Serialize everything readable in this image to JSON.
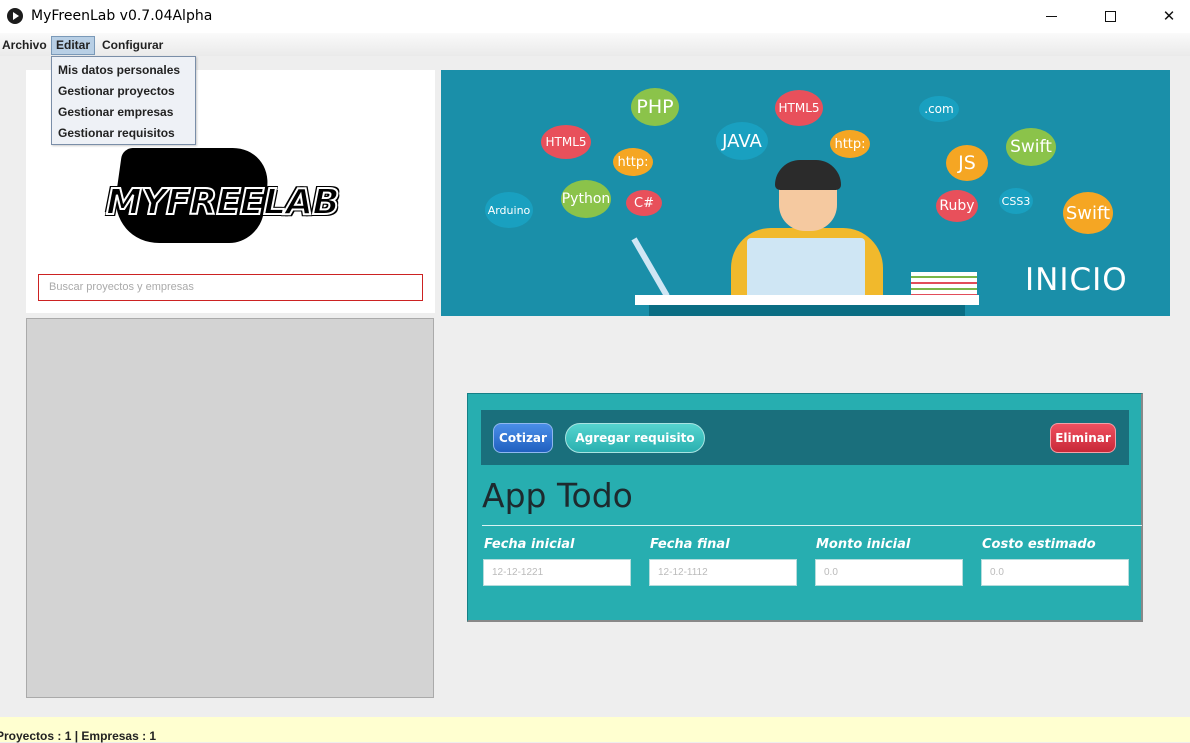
{
  "window": {
    "title": "MyFreenLab v0.7.04Alpha",
    "controls": {
      "minimize": "minimize-icon",
      "maximize": "maximize-icon",
      "close": "✕"
    }
  },
  "menubar": {
    "items": [
      "Archivo",
      "Editar",
      "Configurar"
    ],
    "active": "Editar"
  },
  "editar_menu": {
    "items": [
      "Mis datos personales",
      "Gestionar proyectos",
      "Gestionar empresas",
      "Gestionar requisitos"
    ]
  },
  "logo": {
    "text": "MYFREELAB"
  },
  "search": {
    "placeholder": "Buscar proyectos y empresas"
  },
  "banner": {
    "title": "INICIO",
    "tags": [
      "PHP",
      "HTML5",
      "JAVA",
      "HTML5",
      "http:",
      "http:",
      "Python",
      "C#",
      "Arduino",
      ".com",
      "JS",
      "Swift",
      "Ruby",
      "CSS3",
      "Swift"
    ]
  },
  "project_card": {
    "buttons": {
      "cotizar": "Cotizar",
      "agregar": "Agregar requisito",
      "eliminar": "Eliminar"
    },
    "title": "App Todo",
    "fields": [
      {
        "label": "Fecha inicial",
        "value": "12-12-1221"
      },
      {
        "label": "Fecha final",
        "value": "12-12-1112"
      },
      {
        "label": "Monto inicial",
        "value": "0.0"
      },
      {
        "label": "Costo estimado",
        "value": "0.0"
      }
    ]
  },
  "status": {
    "text": "Proyectos : 1  |  Empresas : 1"
  },
  "colors": {
    "card_bg": "#27aeb0",
    "toolbar_bg": "#1a6f7c",
    "banner_bg": "#1a8fa9",
    "status_bg": "#ffffd0"
  }
}
